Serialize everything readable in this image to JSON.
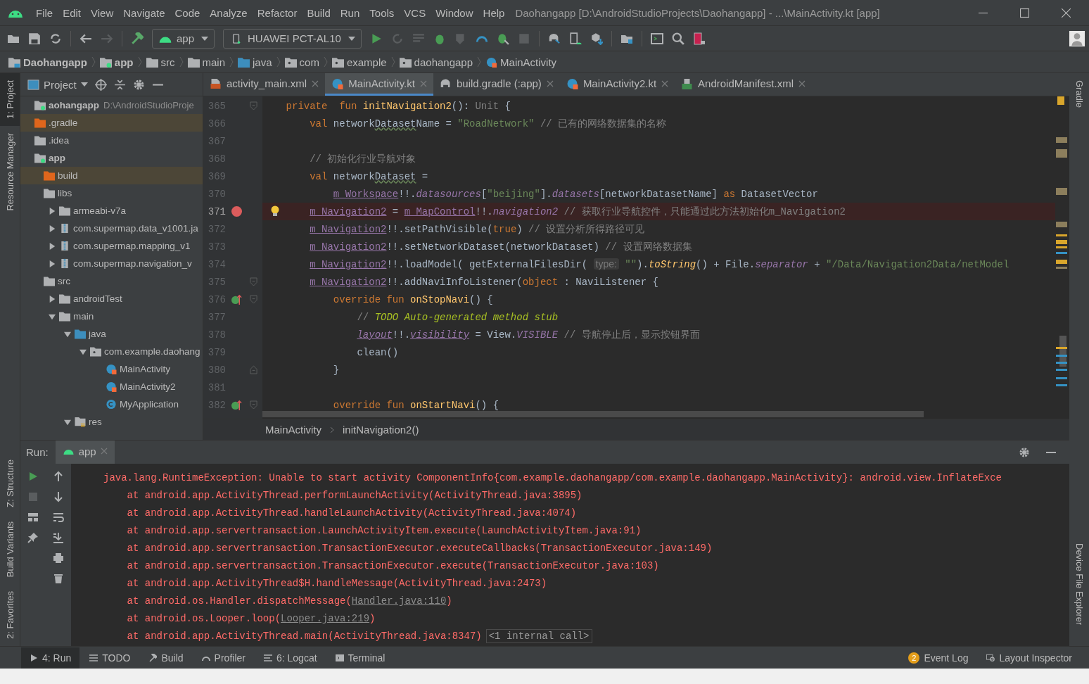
{
  "window": {
    "title": "Daohangapp [D:\\AndroidStudioProjects\\Daohangapp] - ...\\MainActivity.kt [app]"
  },
  "menu": [
    "File",
    "Edit",
    "View",
    "Navigate",
    "Code",
    "Analyze",
    "Refactor",
    "Build",
    "Run",
    "Tools",
    "VCS",
    "Window",
    "Help"
  ],
  "toolbar": {
    "config": "app",
    "device": "HUAWEI PCT-AL10"
  },
  "breadcrumbs": [
    {
      "label": "Daohangapp",
      "kind": "project",
      "bold": true
    },
    {
      "label": "app",
      "kind": "module",
      "bold": true
    },
    {
      "label": "src",
      "kind": "folder",
      "bold": false
    },
    {
      "label": "main",
      "kind": "folder",
      "bold": false
    },
    {
      "label": "java",
      "kind": "source",
      "bold": false
    },
    {
      "label": "com",
      "kind": "package",
      "bold": false
    },
    {
      "label": "example",
      "kind": "package",
      "bold": false
    },
    {
      "label": "daohangapp",
      "kind": "package",
      "bold": false
    },
    {
      "label": "MainActivity",
      "kind": "kotlin",
      "bold": false
    }
  ],
  "left_stripe_top": [
    {
      "label": "1: Project",
      "selected": true
    },
    {
      "label": "Resource Manager",
      "selected": false
    }
  ],
  "left_stripe_bottom": [
    {
      "label": "Z: Structure",
      "selected": false
    },
    {
      "label": "Build Variants",
      "selected": false
    },
    {
      "label": "2: Favorites",
      "selected": false
    }
  ],
  "right_stripe": [
    {
      "label": "Gradle",
      "selected": false
    },
    {
      "label": "Device File Explorer",
      "selected": false
    }
  ],
  "project_panel": {
    "title": "Project",
    "tree": [
      {
        "label": "aohangapp",
        "path": "D:\\AndroidStudioProje",
        "kind": "module",
        "bold": true,
        "excluded": false,
        "children": [
          {
            "label": ".gradle",
            "kind": "excluded",
            "bold": false,
            "excluded": true
          },
          {
            "label": ".idea",
            "kind": "folder",
            "bold": false,
            "excluded": false
          },
          {
            "label": "app",
            "kind": "module",
            "bold": true,
            "excluded": false,
            "children": [
              {
                "label": "build",
                "kind": "excluded",
                "bold": false,
                "excluded": true
              },
              {
                "label": "libs",
                "kind": "folder",
                "bold": false,
                "excluded": false,
                "children": [
                  {
                    "label": "armeabi-v7a",
                    "kind": "folder",
                    "bold": false,
                    "excluded": false,
                    "expanded": false
                  },
                  {
                    "label": "com.supermap.data_v1001.ja",
                    "kind": "jar",
                    "bold": false,
                    "excluded": false,
                    "expanded": false
                  },
                  {
                    "label": "com.supermap.mapping_v1",
                    "kind": "jar",
                    "bold": false,
                    "excluded": false,
                    "expanded": false
                  },
                  {
                    "label": "com.supermap.navigation_v",
                    "kind": "jar",
                    "bold": false,
                    "excluded": false,
                    "expanded": false
                  }
                ]
              },
              {
                "label": "src",
                "kind": "folder",
                "bold": false,
                "excluded": false,
                "children": [
                  {
                    "label": "androidTest",
                    "kind": "folder",
                    "bold": false,
                    "excluded": false,
                    "expanded": false
                  },
                  {
                    "label": "main",
                    "kind": "folder",
                    "bold": false,
                    "excluded": false,
                    "expanded": true,
                    "children": [
                      {
                        "label": "java",
                        "kind": "source",
                        "bold": false,
                        "excluded": false,
                        "expanded": true,
                        "children": [
                          {
                            "label": "com.example.daohang",
                            "kind": "package",
                            "bold": false,
                            "excluded": false,
                            "expanded": true,
                            "children": [
                              {
                                "label": "MainActivity",
                                "kind": "kotlin",
                                "bold": false,
                                "excluded": false
                              },
                              {
                                "label": "MainActivity2",
                                "kind": "kotlin",
                                "bold": false,
                                "excluded": false
                              },
                              {
                                "label": "MyApplication",
                                "kind": "class",
                                "bold": false,
                                "excluded": false
                              }
                            ]
                          }
                        ]
                      },
                      {
                        "label": "res",
                        "kind": "resources",
                        "bold": false,
                        "excluded": false,
                        "expanded": true
                      }
                    ]
                  }
                ]
              }
            ]
          }
        ]
      }
    ]
  },
  "editor": {
    "tabs": [
      {
        "label": "activity_main.xml",
        "kind": "xml",
        "selected": false
      },
      {
        "label": "MainActivity.kt",
        "kind": "kotlin",
        "selected": true
      },
      {
        "label": "build.gradle (:app)",
        "kind": "gradle",
        "selected": false
      },
      {
        "label": "MainActivity2.kt",
        "kind": "kotlin",
        "selected": false
      },
      {
        "label": "AndroidManifest.xml",
        "kind": "manifest",
        "selected": false
      }
    ],
    "lines": [
      {
        "number": "365",
        "breakpoint": false,
        "override": false,
        "fold_start": true,
        "fold_end": false,
        "bulb": false,
        "tokens": [
          {
            "kind": "kw",
            "text": "    private  fun "
          },
          {
            "kind": "fn",
            "text": "initNavigation2"
          },
          {
            "kind": "id",
            "text": "(): "
          },
          {
            "kind": "unit",
            "text": "Unit"
          },
          {
            "kind": "id",
            "text": " {"
          }
        ]
      },
      {
        "number": "366",
        "breakpoint": false,
        "override": false,
        "fold_start": false,
        "fold_end": false,
        "bulb": false,
        "tokens": [
          {
            "kind": "kw",
            "text": "        val "
          },
          {
            "kind": "id",
            "text": "network"
          },
          {
            "kind": "typo",
            "text": "Dataset"
          },
          {
            "kind": "id",
            "text": "Name = "
          },
          {
            "kind": "str",
            "text": "\"RoadNetwork\""
          },
          {
            "kind": "cmt",
            "text": " // 已有的网络数据集的名称"
          }
        ]
      },
      {
        "number": "367",
        "breakpoint": false,
        "override": false,
        "fold_start": false,
        "fold_end": false,
        "bulb": false
      },
      {
        "number": "368",
        "breakpoint": false,
        "override": false,
        "fold_start": false,
        "fold_end": false,
        "bulb": false,
        "tokens": [
          {
            "kind": "cmt",
            "text": "        // 初始化行业导航对象"
          }
        ]
      },
      {
        "number": "369",
        "breakpoint": false,
        "override": false,
        "fold_start": false,
        "fold_end": false,
        "bulb": false,
        "tokens": [
          {
            "kind": "kw",
            "text": "        val "
          },
          {
            "kind": "id",
            "text": "network"
          },
          {
            "kind": "typo",
            "text": "Dataset"
          },
          {
            "kind": "id",
            "text": " ="
          }
        ]
      },
      {
        "number": "370",
        "breakpoint": false,
        "override": false,
        "fold_start": false,
        "fold_end": false,
        "bulb": false,
        "tokens": [
          {
            "kind": "ref",
            "text": "            m_Workspace"
          },
          {
            "kind": "id",
            "text": "!!."
          },
          {
            "kind": "ital",
            "text": "datasources"
          },
          {
            "kind": "id",
            "text": "["
          },
          {
            "kind": "str",
            "text": "\"beijing\""
          },
          {
            "kind": "id",
            "text": "]."
          },
          {
            "kind": "ital",
            "text": "datasets"
          },
          {
            "kind": "id",
            "text": "[networkDatasetName] "
          },
          {
            "kind": "kw",
            "text": "as"
          },
          {
            "kind": "id",
            "text": " DatasetVector"
          }
        ]
      },
      {
        "number": "371",
        "breakpoint": true,
        "override": false,
        "fold_start": false,
        "fold_end": false,
        "bulb": true,
        "tokens": [
          {
            "kind": "ref",
            "text": "        m_Navigation2"
          },
          {
            "kind": "id",
            "text": " = "
          },
          {
            "kind": "ref",
            "text": "m_MapControl"
          },
          {
            "kind": "id",
            "text": "!!."
          },
          {
            "kind": "ital",
            "text": "navigation2"
          },
          {
            "kind": "cmt",
            "text": " // 获取行业导航控件，只能通过此方法初始化m_Navigation2"
          }
        ]
      },
      {
        "number": "372",
        "breakpoint": false,
        "override": false,
        "fold_start": false,
        "fold_end": false,
        "bulb": false,
        "tokens": [
          {
            "kind": "ref",
            "text": "        m_Navigation2"
          },
          {
            "kind": "id",
            "text": "!!.setPathVisible("
          },
          {
            "kind": "kw",
            "text": "true"
          },
          {
            "kind": "id",
            "text": ")"
          },
          {
            "kind": "cmt",
            "text": " // 设置分析所得路径可见"
          }
        ]
      },
      {
        "number": "373",
        "breakpoint": false,
        "override": false,
        "fold_start": false,
        "fold_end": false,
        "bulb": false,
        "tokens": [
          {
            "kind": "ref",
            "text": "        m_Navigation2"
          },
          {
            "kind": "id",
            "text": "!!.setNetworkDataset(networkDataset)"
          },
          {
            "kind": "cmt",
            "text": " // 设置网络数据集"
          }
        ]
      },
      {
        "number": "374",
        "breakpoint": false,
        "override": false,
        "fold_start": false,
        "fold_end": false,
        "bulb": false,
        "tokens": [
          {
            "kind": "ref",
            "text": "        m_Navigation2"
          },
          {
            "kind": "id",
            "text": "!!.loadModel( getExternalFilesDir( "
          },
          {
            "kind": "hint",
            "text": "type:"
          },
          {
            "kind": "str",
            "text": " \"\""
          },
          {
            "kind": "id",
            "text": ")."
          },
          {
            "kind": "fni",
            "text": "toString"
          },
          {
            "kind": "id",
            "text": "() + File."
          },
          {
            "kind": "ital",
            "text": "separator"
          },
          {
            "kind": "id",
            "text": " + "
          },
          {
            "kind": "str",
            "text": "\"/Data/Navigation2Data/netModel"
          }
        ]
      },
      {
        "number": "375",
        "breakpoint": false,
        "override": false,
        "fold_start": true,
        "fold_end": false,
        "bulb": false,
        "tokens": [
          {
            "kind": "ref",
            "text": "        m_Navigation2"
          },
          {
            "kind": "id",
            "text": "!!.addNaviInfoListener("
          },
          {
            "kind": "kw",
            "text": "object"
          },
          {
            "kind": "id",
            "text": " : NaviListener {"
          }
        ]
      },
      {
        "number": "376",
        "breakpoint": false,
        "override": true,
        "fold_start": true,
        "fold_end": false,
        "bulb": false,
        "tokens": [
          {
            "kind": "kw",
            "text": "            override fun "
          },
          {
            "kind": "fn",
            "text": "onStopNavi"
          },
          {
            "kind": "id",
            "text": "() {"
          }
        ]
      },
      {
        "number": "377",
        "breakpoint": false,
        "override": false,
        "fold_start": false,
        "fold_end": false,
        "bulb": false,
        "tokens": [
          {
            "kind": "cmt",
            "text": "                // "
          },
          {
            "kind": "todo",
            "text": "TODO Auto-generated method stub"
          }
        ]
      },
      {
        "number": "378",
        "breakpoint": false,
        "override": false,
        "fold_start": false,
        "fold_end": false,
        "bulb": false,
        "tokens": [
          {
            "kind": "italu",
            "text": "                layout"
          },
          {
            "kind": "id",
            "text": "!!."
          },
          {
            "kind": "italu",
            "text": "visibility"
          },
          {
            "kind": "id",
            "text": " = View."
          },
          {
            "kind": "ital",
            "text": "VISIBLE"
          },
          {
            "kind": "cmt",
            "text": " // 导航停止后，显示按钮界面"
          }
        ]
      },
      {
        "number": "379",
        "breakpoint": false,
        "override": false,
        "fold_start": false,
        "fold_end": false,
        "bulb": false,
        "tokens": [
          {
            "kind": "id",
            "text": "                clean()"
          }
        ]
      },
      {
        "number": "380",
        "breakpoint": false,
        "override": false,
        "fold_start": false,
        "fold_end": true,
        "bulb": false,
        "tokens": [
          {
            "kind": "id",
            "text": "            }"
          }
        ]
      },
      {
        "number": "381",
        "breakpoint": false,
        "override": false,
        "fold_start": false,
        "fold_end": false,
        "bulb": false
      },
      {
        "number": "382",
        "breakpoint": false,
        "override": true,
        "fold_start": true,
        "fold_end": false,
        "bulb": false,
        "tokens": [
          {
            "kind": "kw",
            "text": "            override fun "
          },
          {
            "kind": "fn",
            "text": "onStartNavi"
          },
          {
            "kind": "id",
            "text": "() {"
          }
        ]
      }
    ],
    "breadcrumbs": [
      "MainActivity",
      "initNavigation2()"
    ]
  },
  "run_panel": {
    "label": "Run:",
    "tabs": [
      {
        "label": "app",
        "selected": true
      }
    ],
    "console": [
      [
        {
          "kind": "txt",
          "text": "java.lang.RuntimeException: Unable to start activity ComponentInfo{com.example.daohangapp/com.example.daohangapp.MainActivity}: android.view.InflateExce"
        }
      ],
      [
        {
          "kind": "txt",
          "text": "    at android.app.ActivityThread.performLaunchActivity(ActivityThread.java:3895)"
        }
      ],
      [
        {
          "kind": "txt",
          "text": "    at android.app.ActivityThread.handleLaunchActivity(ActivityThread.java:4074)"
        }
      ],
      [
        {
          "kind": "txt",
          "text": "    at android.app.servertransaction.LaunchActivityItem.execute(LaunchActivityItem.java:91)"
        }
      ],
      [
        {
          "kind": "txt",
          "text": "    at android.app.servertransaction.TransactionExecutor.executeCallbacks(TransactionExecutor.java:149)"
        }
      ],
      [
        {
          "kind": "txt",
          "text": "    at android.app.servertransaction.TransactionExecutor.execute(TransactionExecutor.java:103)"
        }
      ],
      [
        {
          "kind": "txt",
          "text": "    at android.app.ActivityThread$H.handleMessage(ActivityThread.java:2473)"
        }
      ],
      [
        {
          "kind": "txt",
          "text": "    at android.os.Handler.dispatchMessage("
        },
        {
          "kind": "link",
          "text": "Handler.java:110"
        },
        {
          "kind": "txt",
          "text": ")"
        }
      ],
      [
        {
          "kind": "txt",
          "text": "    at android.os.Looper.loop("
        },
        {
          "kind": "link",
          "text": "Looper.java:219"
        },
        {
          "kind": "txt",
          "text": ")"
        }
      ],
      [
        {
          "kind": "txt",
          "text": "    at android.app.ActivityThread.main(ActivityThread.java:8347)"
        },
        {
          "kind": "fold",
          "text": "<1 internal call>"
        }
      ]
    ]
  },
  "bottom_tools": [
    {
      "label": "4: Run",
      "kind": "run",
      "selected": true
    },
    {
      "label": "TODO",
      "kind": "todo",
      "selected": false
    },
    {
      "label": "Build",
      "kind": "build",
      "selected": false
    },
    {
      "label": "Profiler",
      "kind": "profiler",
      "selected": false
    },
    {
      "label": "6: Logcat",
      "kind": "logcat",
      "selected": false
    },
    {
      "label": "Terminal",
      "kind": "terminal",
      "selected": false
    }
  ],
  "bottom_tools_right": [
    {
      "label": "Event Log",
      "badge": "2"
    },
    {
      "label": "Layout Inspector"
    }
  ]
}
